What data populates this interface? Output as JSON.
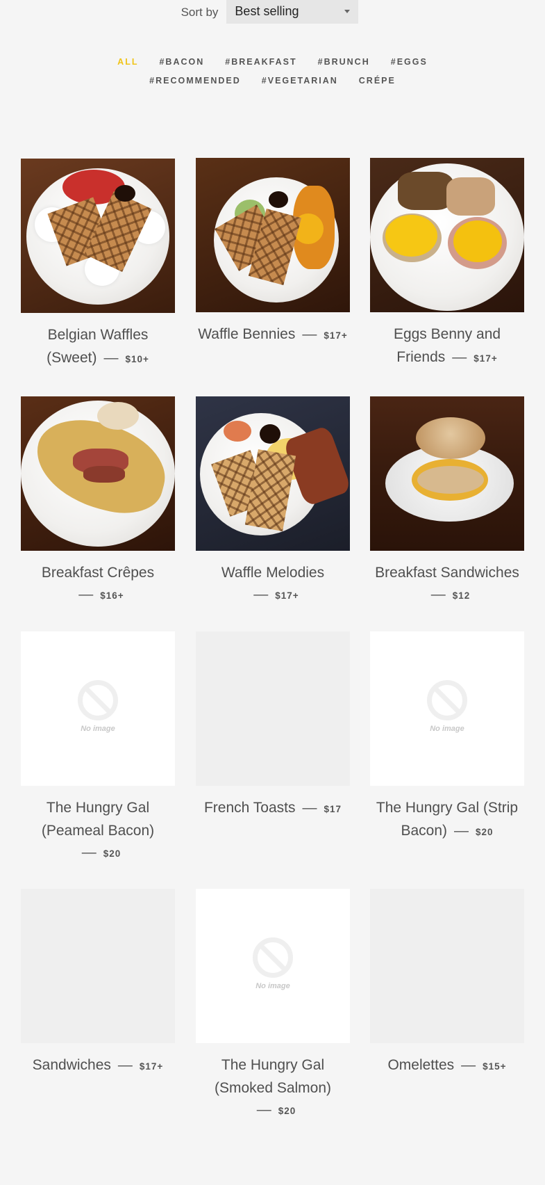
{
  "sort": {
    "label": "Sort by",
    "value": "Best selling"
  },
  "tags": {
    "row1": [
      "ALL",
      "#BACON",
      "#BREAKFAST",
      "#BRUNCH",
      "#EGGS"
    ],
    "row2": [
      "#RECOMMENDED",
      "#VEGETARIAN",
      "CRÉPE"
    ]
  },
  "colors": {
    "active_tag": "#f0c419",
    "background": "#f5f5f5"
  },
  "dash": "—",
  "no_image_text": "No image",
  "products": [
    {
      "name": "Belgian Waffles (Sweet)",
      "price": "$10+"
    },
    {
      "name": "Waffle Bennies",
      "price": "$17+"
    },
    {
      "name": "Eggs Benny and Friends",
      "price": "$17+"
    },
    {
      "name": "Breakfast Crêpes",
      "price": "$16+"
    },
    {
      "name": "Waffle Melodies",
      "price": "$17+"
    },
    {
      "name": "Breakfast Sandwiches",
      "price": "$12"
    },
    {
      "name": "The Hungry Gal (Peameal Bacon)",
      "price": "$20"
    },
    {
      "name": "French Toasts",
      "price": "$17"
    },
    {
      "name": "The Hungry Gal (Strip Bacon)",
      "price": "$20"
    },
    {
      "name": "Sandwiches",
      "price": "$17+"
    },
    {
      "name": "The Hungry Gal (Smoked Salmon)",
      "price": "$20"
    },
    {
      "name": "Omelettes",
      "price": "$15+"
    }
  ]
}
